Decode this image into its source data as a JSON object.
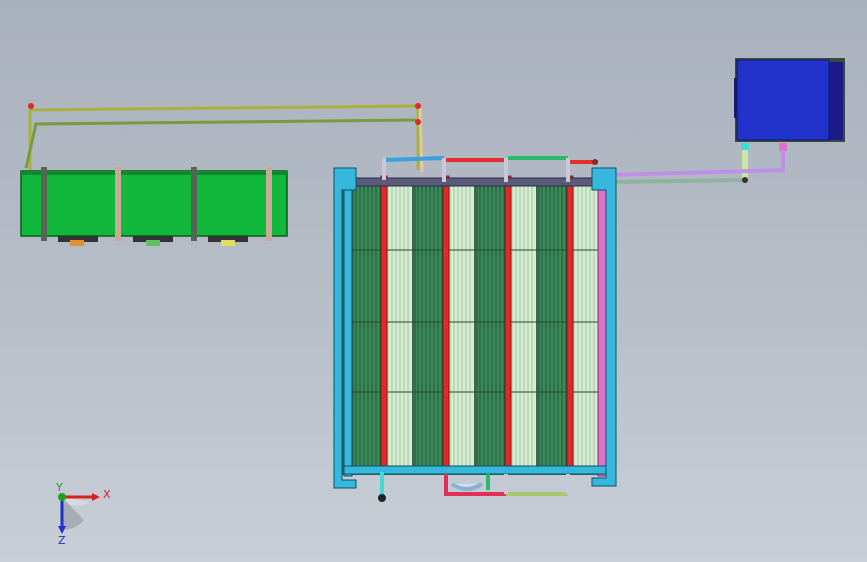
{
  "viewport": {
    "background_top": "#a9b1bd",
    "background_bottom": "#c9cfd6"
  },
  "model": {
    "condenser_unit": {
      "color": "#12b83b",
      "fan_count": 3
    },
    "control_box": {
      "color": "#2233cc",
      "frame_color": "#3a4a3a"
    },
    "frame": {
      "color": "#35b8dc"
    },
    "coil_panels": {
      "count": 4,
      "fin_color": "#3c8a5a",
      "tube_color": "#e02a2a"
    },
    "pipe_colors": {
      "red": "#e0302a",
      "blue": "#3aa0e0",
      "green": "#2ab86a",
      "magenta": "#e070c8",
      "cyan": "#46d8d8",
      "olive": "#a8b040",
      "violet": "#c090e8"
    }
  },
  "triad": {
    "x_label": "X",
    "y_label": "Y",
    "z_label": "Z",
    "x_color": "#d62020",
    "y_color": "#20a020",
    "z_color": "#2030d0"
  }
}
